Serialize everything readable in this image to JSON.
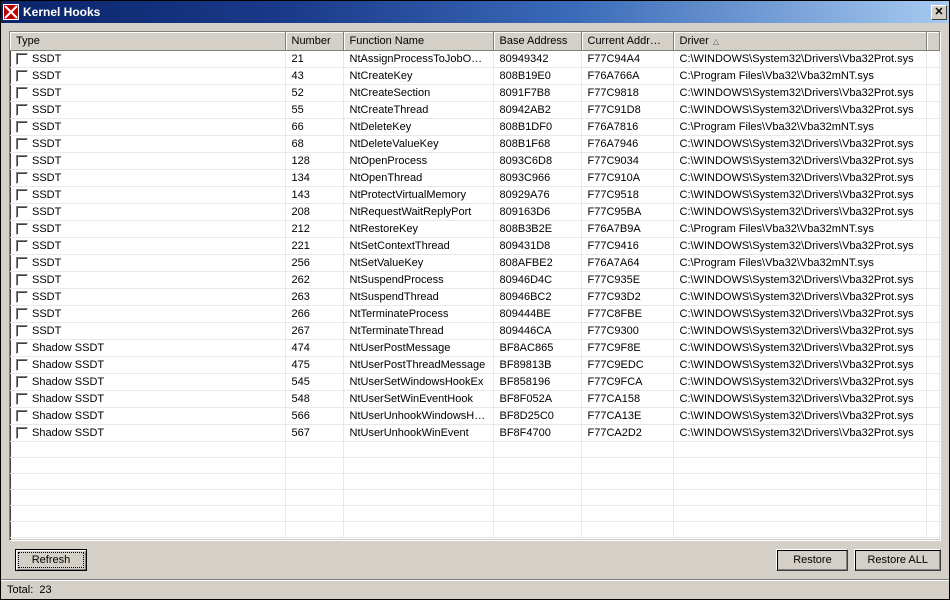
{
  "window": {
    "title": "Kernel Hooks",
    "close_glyph": "✕"
  },
  "columns": {
    "type": "Type",
    "number": "Number",
    "func": "Function Name",
    "base": "Base Address",
    "curr": "Current Address",
    "driver": "Driver",
    "sort_glyph": "△"
  },
  "rows": [
    {
      "type": "SSDT",
      "number": "21",
      "func": "NtAssignProcessToJobObj...",
      "base": "80949342",
      "curr": "F77C94A4",
      "driver": "C:\\WINDOWS\\System32\\Drivers\\Vba32Prot.sys"
    },
    {
      "type": "SSDT",
      "number": "43",
      "func": "NtCreateKey",
      "base": "808B19E0",
      "curr": "F76A766A",
      "driver": "C:\\Program Files\\Vba32\\Vba32mNT.sys"
    },
    {
      "type": "SSDT",
      "number": "52",
      "func": "NtCreateSection",
      "base": "8091F7B8",
      "curr": "F77C9818",
      "driver": "C:\\WINDOWS\\System32\\Drivers\\Vba32Prot.sys"
    },
    {
      "type": "SSDT",
      "number": "55",
      "func": "NtCreateThread",
      "base": "80942AB2",
      "curr": "F77C91D8",
      "driver": "C:\\WINDOWS\\System32\\Drivers\\Vba32Prot.sys"
    },
    {
      "type": "SSDT",
      "number": "66",
      "func": "NtDeleteKey",
      "base": "808B1DF0",
      "curr": "F76A7816",
      "driver": "C:\\Program Files\\Vba32\\Vba32mNT.sys"
    },
    {
      "type": "SSDT",
      "number": "68",
      "func": "NtDeleteValueKey",
      "base": "808B1F68",
      "curr": "F76A7946",
      "driver": "C:\\WINDOWS\\System32\\Drivers\\Vba32Prot.sys"
    },
    {
      "type": "SSDT",
      "number": "128",
      "func": "NtOpenProcess",
      "base": "8093C6D8",
      "curr": "F77C9034",
      "driver": "C:\\WINDOWS\\System32\\Drivers\\Vba32Prot.sys"
    },
    {
      "type": "SSDT",
      "number": "134",
      "func": "NtOpenThread",
      "base": "8093C966",
      "curr": "F77C910A",
      "driver": "C:\\WINDOWS\\System32\\Drivers\\Vba32Prot.sys"
    },
    {
      "type": "SSDT",
      "number": "143",
      "func": "NtProtectVirtualMemory",
      "base": "80929A76",
      "curr": "F77C9518",
      "driver": "C:\\WINDOWS\\System32\\Drivers\\Vba32Prot.sys"
    },
    {
      "type": "SSDT",
      "number": "208",
      "func": "NtRequestWaitReplyPort",
      "base": "809163D6",
      "curr": "F77C95BA",
      "driver": "C:\\WINDOWS\\System32\\Drivers\\Vba32Prot.sys"
    },
    {
      "type": "SSDT",
      "number": "212",
      "func": "NtRestoreKey",
      "base": "808B3B2E",
      "curr": "F76A7B9A",
      "driver": "C:\\Program Files\\Vba32\\Vba32mNT.sys"
    },
    {
      "type": "SSDT",
      "number": "221",
      "func": "NtSetContextThread",
      "base": "809431D8",
      "curr": "F77C9416",
      "driver": "C:\\WINDOWS\\System32\\Drivers\\Vba32Prot.sys"
    },
    {
      "type": "SSDT",
      "number": "256",
      "func": "NtSetValueKey",
      "base": "808AFBE2",
      "curr": "F76A7A64",
      "driver": "C:\\Program Files\\Vba32\\Vba32mNT.sys"
    },
    {
      "type": "SSDT",
      "number": "262",
      "func": "NtSuspendProcess",
      "base": "80946D4C",
      "curr": "F77C935E",
      "driver": "C:\\WINDOWS\\System32\\Drivers\\Vba32Prot.sys"
    },
    {
      "type": "SSDT",
      "number": "263",
      "func": "NtSuspendThread",
      "base": "80946BC2",
      "curr": "F77C93D2",
      "driver": "C:\\WINDOWS\\System32\\Drivers\\Vba32Prot.sys"
    },
    {
      "type": "SSDT",
      "number": "266",
      "func": "NtTerminateProcess",
      "base": "809444BE",
      "curr": "F77C8FBE",
      "driver": "C:\\WINDOWS\\System32\\Drivers\\Vba32Prot.sys"
    },
    {
      "type": "SSDT",
      "number": "267",
      "func": "NtTerminateThread",
      "base": "809446CA",
      "curr": "F77C9300",
      "driver": "C:\\WINDOWS\\System32\\Drivers\\Vba32Prot.sys"
    },
    {
      "type": "Shadow SSDT",
      "number": "474",
      "func": "NtUserPostMessage",
      "base": "BF8AC865",
      "curr": "F77C9F8E",
      "driver": "C:\\WINDOWS\\System32\\Drivers\\Vba32Prot.sys"
    },
    {
      "type": "Shadow SSDT",
      "number": "475",
      "func": "NtUserPostThreadMessage",
      "base": "BF89813B",
      "curr": "F77C9EDC",
      "driver": "C:\\WINDOWS\\System32\\Drivers\\Vba32Prot.sys"
    },
    {
      "type": "Shadow SSDT",
      "number": "545",
      "func": "NtUserSetWindowsHookEx",
      "base": "BF858196",
      "curr": "F77C9FCA",
      "driver": "C:\\WINDOWS\\System32\\Drivers\\Vba32Prot.sys"
    },
    {
      "type": "Shadow SSDT",
      "number": "548",
      "func": "NtUserSetWinEventHook",
      "base": "BF8F052A",
      "curr": "F77CA158",
      "driver": "C:\\WINDOWS\\System32\\Drivers\\Vba32Prot.sys"
    },
    {
      "type": "Shadow SSDT",
      "number": "566",
      "func": "NtUserUnhookWindowsHo...",
      "base": "BF8D25C0",
      "curr": "F77CA13E",
      "driver": "C:\\WINDOWS\\System32\\Drivers\\Vba32Prot.sys"
    },
    {
      "type": "Shadow SSDT",
      "number": "567",
      "func": "NtUserUnhookWinEvent",
      "base": "BF8F4700",
      "curr": "F77CA2D2",
      "driver": "C:\\WINDOWS\\System32\\Drivers\\Vba32Prot.sys"
    }
  ],
  "empty_rows": 6,
  "buttons": {
    "refresh": "Refresh",
    "restore": "Restore",
    "restore_all": "Restore ALL"
  },
  "status": {
    "total_label": "Total:",
    "total_value": "23"
  }
}
